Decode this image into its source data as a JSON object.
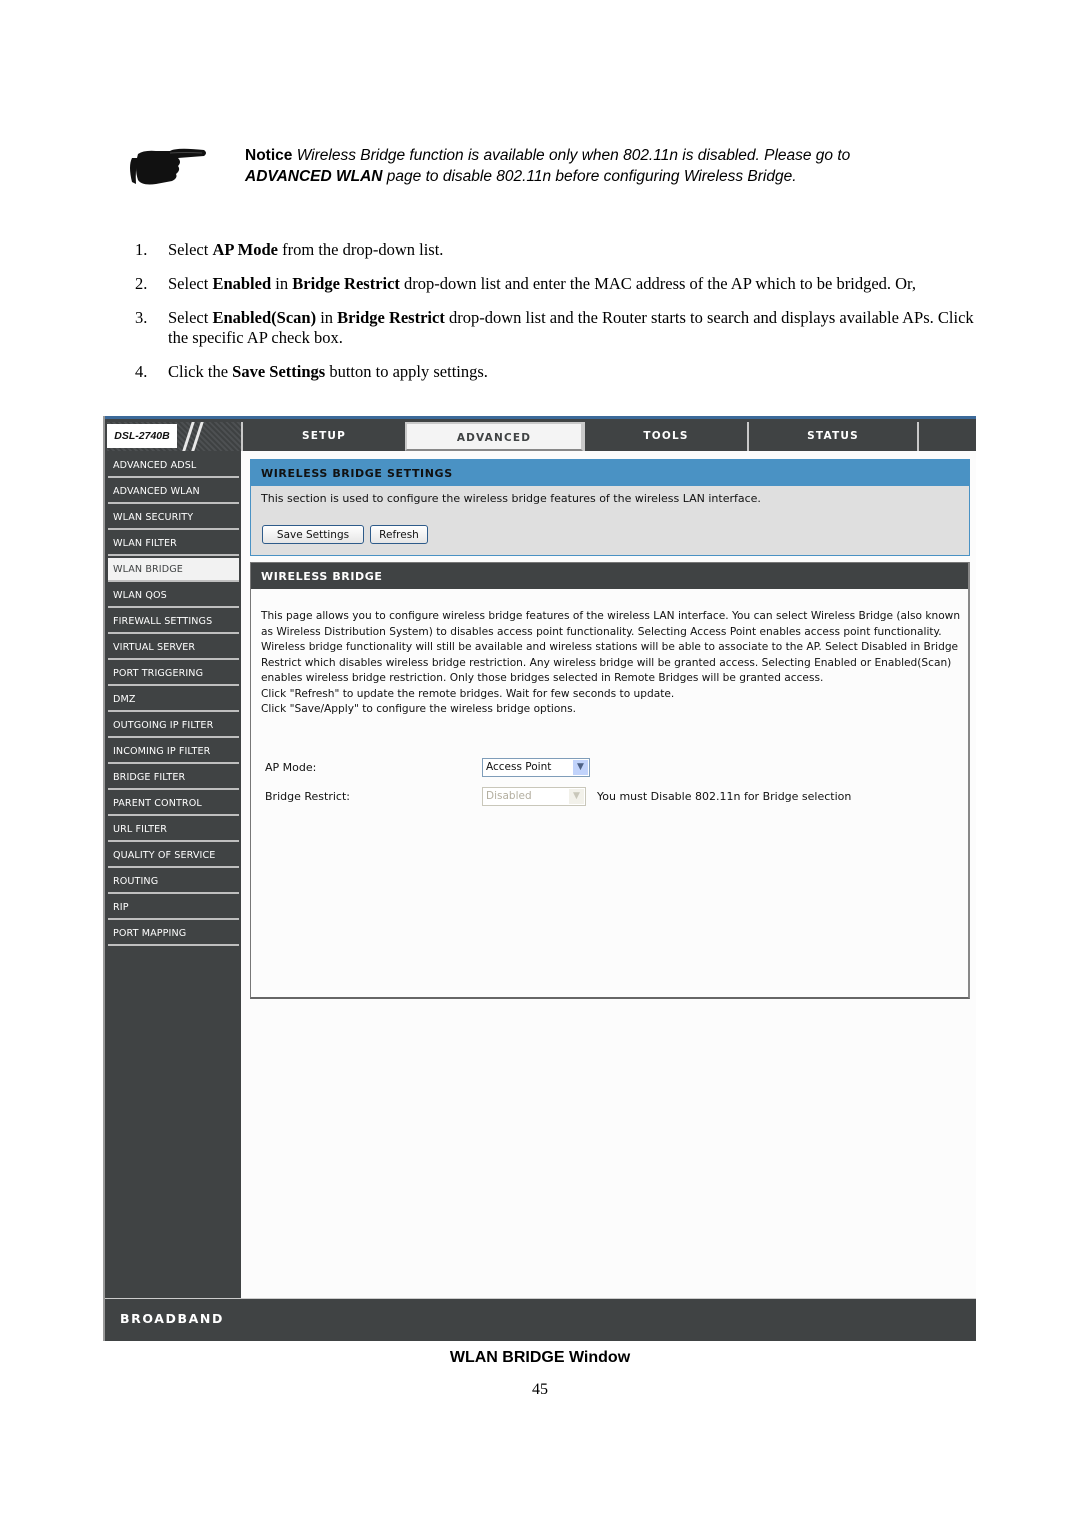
{
  "notice": {
    "icon": "pointing-hand-icon",
    "label": "Notice",
    "line1": "Wireless Bridge function is available only when 802.11n is disabled. Please go to",
    "link": "ADVANCED WLAN",
    "line2": "page to disable 802.11n before configuring Wireless Bridge."
  },
  "steps": [
    {
      "num": "1.",
      "parts": [
        {
          "t": "Select "
        },
        {
          "b": "AP Mode"
        },
        {
          "t": " from the drop-down list."
        }
      ]
    },
    {
      "num": "2.",
      "parts": [
        {
          "t": "Select "
        },
        {
          "b": "Enabled"
        },
        {
          "t": " in "
        },
        {
          "b": "Bridge Restrict"
        },
        {
          "t": " drop-down list and enter the MAC address of the AP which to be bridged. Or,"
        }
      ]
    },
    {
      "num": "3.",
      "parts": [
        {
          "t": "Select "
        },
        {
          "b": "Enabled(Scan)"
        },
        {
          "t": " in "
        },
        {
          "b": "Bridge Restrict"
        },
        {
          "t": " drop-down list and the Router starts to search and displays available APs. Click the specific AP check box."
        }
      ]
    },
    {
      "num": "4.",
      "parts": [
        {
          "t": "Click the "
        },
        {
          "b": "Save Settings"
        },
        {
          "t": " button to apply settings."
        }
      ]
    }
  ],
  "router": {
    "model": "DSL-2740B",
    "tabs": [
      {
        "label": "SETUP",
        "active": false
      },
      {
        "label": "ADVANCED",
        "active": true
      },
      {
        "label": "TOOLS",
        "active": false
      },
      {
        "label": "STATUS",
        "active": false
      }
    ],
    "sidebar": [
      {
        "label": "ADVANCED ADSL"
      },
      {
        "label": "ADVANCED WLAN"
      },
      {
        "label": "WLAN SECURITY"
      },
      {
        "label": "WLAN FILTER"
      },
      {
        "label": "WLAN BRIDGE",
        "active": true
      },
      {
        "label": "WLAN QOS"
      },
      {
        "label": "FIREWALL SETTINGS"
      },
      {
        "label": "VIRTUAL SERVER"
      },
      {
        "label": "PORT TRIGGERING"
      },
      {
        "label": "DMZ"
      },
      {
        "label": "OUTGOING IP FILTER"
      },
      {
        "label": "INCOMING IP FILTER"
      },
      {
        "label": "BRIDGE FILTER"
      },
      {
        "label": "PARENT CONTROL"
      },
      {
        "label": "URL FILTER"
      },
      {
        "label": "QUALITY OF SERVICE"
      },
      {
        "label": "ROUTING"
      },
      {
        "label": "RIP"
      },
      {
        "label": "PORT MAPPING"
      }
    ],
    "settings_box": {
      "title": "WIRELESS BRIDGE SETTINGS",
      "description": "This section is used to configure the wireless bridge features of the wireless LAN interface.",
      "save_label": "Save Settings",
      "refresh_label": "Refresh"
    },
    "bridge_box": {
      "title": "WIRELESS BRIDGE",
      "paragraph": "This page allows you to configure wireless bridge features of the wireless LAN interface. You can select Wireless Bridge (also known as Wireless Distribution System) to disables access point functionality. Selecting Access Point enables access point functionality. Wireless bridge functionality will still be available and wireless stations will be able to associate to the AP. Select Disabled in Bridge Restrict which disables wireless bridge restriction. Any wireless bridge will be granted access. Selecting Enabled or Enabled(Scan) enables wireless bridge restriction. Only those bridges selected in Remote Bridges will be granted access.",
      "hint1": "Click \"Refresh\" to update the remote bridges. Wait for few seconds to update.",
      "hint2": "Click \"Save/Apply\" to configure the wireless bridge options.",
      "ap_mode_label": "AP Mode:",
      "ap_mode_value": "Access Point",
      "bridge_restrict_label": "Bridge Restrict:",
      "bridge_restrict_value": "Disabled",
      "bridge_restrict_note": "You must Disable 802.11n for Bridge selection"
    },
    "footer_brand": "BROADBAND"
  },
  "caption": "WLAN BRIDGE Window",
  "page_number": "45"
}
